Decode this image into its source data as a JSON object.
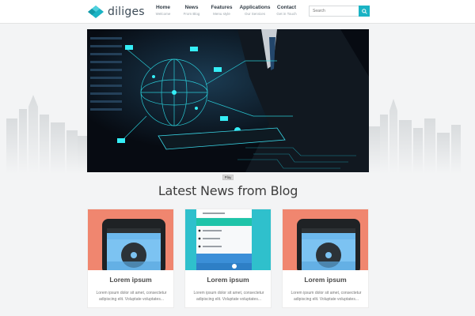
{
  "brand": {
    "name": "diliges",
    "accent": "#1ab3c4"
  },
  "nav": [
    {
      "title": "Home",
      "sub": "Welcome"
    },
    {
      "title": "News",
      "sub": "From Blog"
    },
    {
      "title": "Features",
      "sub": "Menu style"
    },
    {
      "title": "Applications",
      "sub": "Our Services"
    },
    {
      "title": "Contact",
      "sub": "Get in Touch"
    }
  ],
  "search": {
    "placeholder": "Search",
    "icon": "search-icon"
  },
  "slider": {
    "play_label": "Play"
  },
  "section": {
    "title": "Latest News from Blog"
  },
  "cards": [
    {
      "title": "Lorem ipsum",
      "body": "Lorem ipsum dolor sit amet, consectetur adipiscing elit. Voluptate voluptates..."
    },
    {
      "title": "Lorem ipsum",
      "body": "Lorem ipsum dolor sit amet, consectetur adipiscing elit. Voluptate voluptates..."
    },
    {
      "title": "Lorem ipsum",
      "body": "Lorem ipsum dolor sit amet, consectetur adipiscing elit. Voluptate voluptates..."
    }
  ]
}
